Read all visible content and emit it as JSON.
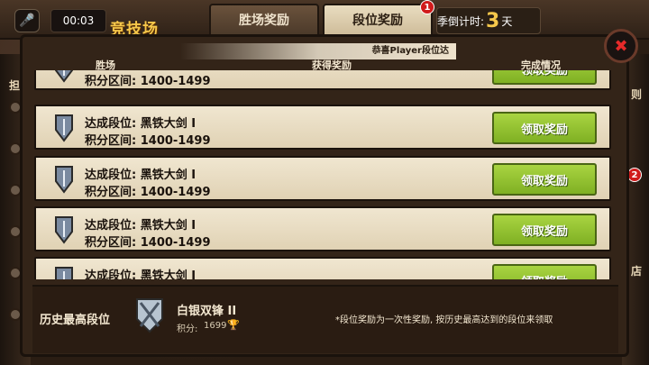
{
  "header": {
    "mic_icon": "microphone-icon",
    "timer": "00:03",
    "game_title": "竞技场",
    "tabs": [
      {
        "label": "胜场奖励",
        "active": false
      },
      {
        "label": "段位奖励",
        "active": true,
        "badge": "1"
      }
    ],
    "countdown_prefix": "季倒计时:",
    "countdown_value": "3",
    "countdown_unit": "天"
  },
  "notice": "恭喜Player段位达",
  "columns": [
    "胜场",
    "获得奖励",
    "完成情况"
  ],
  "rows": [
    {
      "line1": "",
      "line2": "积分区间: 1400-1499",
      "button": "领取奖励"
    },
    {
      "line1": "达成段位: 黑铁大剑 I",
      "line2": "积分区间: 1400-1499",
      "button": "领取奖励"
    },
    {
      "line1": "达成段位: 黑铁大剑 I",
      "line2": "积分区间: 1400-1499",
      "button": "领取奖励"
    },
    {
      "line1": "达成段位: 黑铁大剑 I",
      "line2": "积分区间: 1400-1499",
      "button": "领取奖励"
    },
    {
      "line1": "达成段位: 黑铁大剑 I",
      "line2": "",
      "button": "领取奖励"
    }
  ],
  "footer": {
    "label": "历史最高段位",
    "rank": "白银双锋 II",
    "score_label": "积分:",
    "score": "1699",
    "note": "*段位奖励为一次性奖励, 按历史最高达到的段位来领取"
  },
  "side": {
    "right_1": "则",
    "right_2": "店",
    "right_badge": "2",
    "left_1": "担"
  },
  "colors": {
    "accent_gold": "#f6c84b",
    "button_green": "#8fc22e",
    "close_red": "#e62a2a",
    "row_bg": "#efe3cd"
  }
}
